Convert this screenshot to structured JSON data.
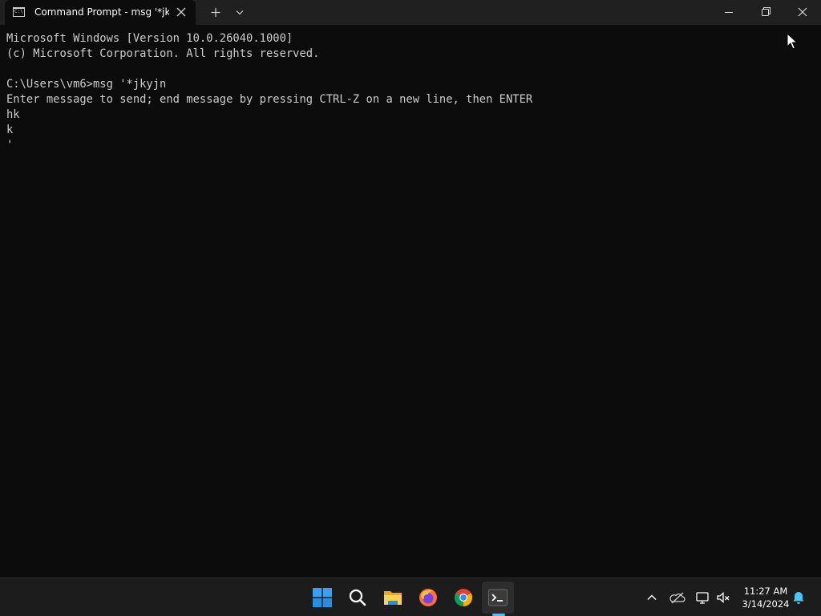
{
  "window": {
    "tab_title": "Command Prompt - msg  '*jkyjn",
    "tab_icon": "cmd-icon",
    "controls": [
      "new-tab-icon",
      "dropdown-icon",
      "minimize-icon",
      "maximize-icon",
      "close-icon"
    ]
  },
  "console": {
    "lines": [
      "Microsoft Windows [Version 10.0.26040.1000]",
      "(c) Microsoft Corporation. All rights reserved.",
      "",
      "C:\\Users\\vm6>msg '*jkyjn",
      "Enter message to send; end message by pressing CTRL-Z on a new line, then ENTER",
      "hk",
      "k",
      "'"
    ]
  },
  "taskbar": {
    "apps": [
      "start-icon",
      "search-icon",
      "file-explorer-icon",
      "firefox-icon",
      "chrome-icon",
      "terminal-icon"
    ],
    "active_app": "terminal-icon",
    "tray": [
      "chevron-up-icon",
      "onedrive-icon",
      "network-icon",
      "volume-muted-icon",
      "notification-bell-icon"
    ],
    "time": "11:27 AM",
    "date": "3/14/2024"
  },
  "colors": {
    "console_bg": "#0c0c0c",
    "console_text": "#cccccc",
    "titlebar_bg": "#202020",
    "taskbar_bg": "#1c1c1c",
    "accent": "#4cc2ff"
  }
}
